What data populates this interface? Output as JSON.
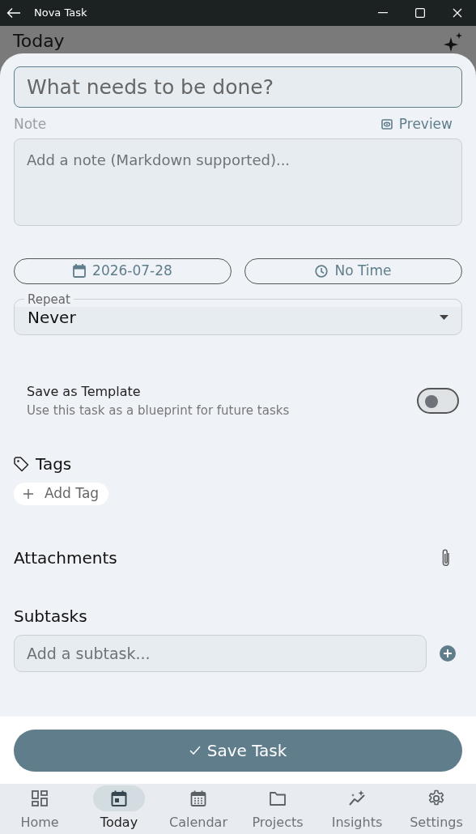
{
  "window": {
    "title": "Nova Task"
  },
  "page": {
    "title": "Today"
  },
  "form": {
    "title_placeholder": "What needs to be done?",
    "note_label": "Note",
    "preview_label": "Preview",
    "note_placeholder": "Add a note (Markdown supported)...",
    "date": "2026-07-28",
    "time": "No Time",
    "repeat_label": "Repeat",
    "repeat_value": "Never",
    "template": {
      "title": "Save as Template",
      "subtitle": "Use this task as a blueprint for future tasks",
      "on": false
    },
    "tags_heading": "Tags",
    "add_tag": "Add Tag",
    "attachments_heading": "Attachments",
    "subtasks_heading": "Subtasks",
    "subtask_placeholder": "Add a subtask...",
    "save_label": "Save Task"
  },
  "nav": [
    {
      "label": "Home",
      "kind": "home",
      "selected": false
    },
    {
      "label": "Today",
      "kind": "today",
      "selected": true
    },
    {
      "label": "Calendar",
      "kind": "calendar",
      "selected": false
    },
    {
      "label": "Projects",
      "kind": "folder",
      "selected": false
    },
    {
      "label": "Insights",
      "kind": "insights",
      "selected": false
    },
    {
      "label": "Settings",
      "kind": "settings",
      "selected": false
    }
  ]
}
